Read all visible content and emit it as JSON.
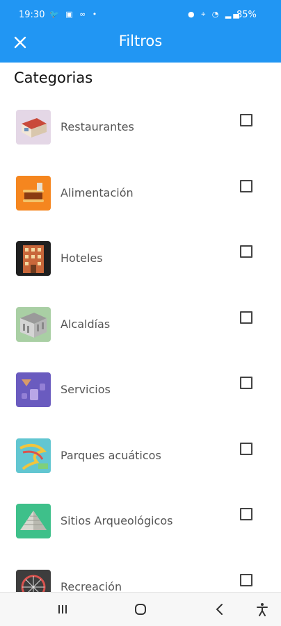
{
  "status": {
    "time": "19:30",
    "battery": "85%"
  },
  "appbar": {
    "title": "Filtros",
    "close_icon": "close-icon"
  },
  "section": {
    "title": "Categorias"
  },
  "categories": [
    {
      "label": "Restaurantes",
      "icon": "restaurant-thumbnail",
      "checked": false
    },
    {
      "label": "Alimentación",
      "icon": "food-thumbnail",
      "checked": false
    },
    {
      "label": "Hoteles",
      "icon": "hotel-thumbnail",
      "checked": false
    },
    {
      "label": "Alcaldías",
      "icon": "city-hall-thumbnail",
      "checked": false
    },
    {
      "label": "Servicios",
      "icon": "services-thumbnail",
      "checked": false
    },
    {
      "label": "Parques acuáticos",
      "icon": "water-park-thumbnail",
      "checked": false
    },
    {
      "label": "Sitios Arqueológicos",
      "icon": "archaeological-site-thumbnail",
      "checked": false
    },
    {
      "label": "Recreación",
      "icon": "recreation-thumbnail",
      "checked": false
    }
  ],
  "colors": {
    "appbar": "#2196F3"
  }
}
